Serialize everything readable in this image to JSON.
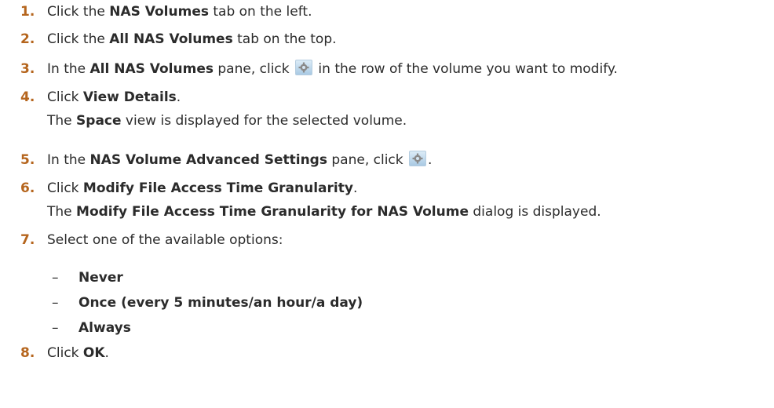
{
  "steps": [
    {
      "num": "1.",
      "pre": "Click the ",
      "bold": "NAS Volumes",
      "post": " tab on the left."
    },
    {
      "num": "2.",
      "pre": "Click the ",
      "bold": "All NAS Volumes",
      "post": " tab on the top."
    },
    {
      "num": "3.",
      "pre": "In the ",
      "bold": "All NAS Volumes",
      "mid": " pane, click ",
      "post": " in the row of the volume you want to modify."
    },
    {
      "num": "4.",
      "pre": "Click ",
      "bold": "View Details",
      "post": "."
    },
    {
      "num": "5.",
      "pre": "In the ",
      "bold": "NAS Volume Advanced Settings",
      "mid": " pane, click ",
      "post": "."
    },
    {
      "num": "6.",
      "pre": "Click ",
      "bold": "Modify File Access Time Granularity",
      "post": "."
    },
    {
      "num": "7.",
      "pre": "Select one of the available options:"
    },
    {
      "num": "8.",
      "pre": "Click ",
      "bold": "OK",
      "post": "."
    }
  ],
  "step4_note": {
    "pre": "The ",
    "bold": "Space",
    "post": " view is displayed for the selected volume."
  },
  "step6_note": {
    "pre": "The ",
    "bold": "Modify File Access Time Granularity for NAS Volume",
    "post": " dialog is displayed."
  },
  "options": {
    "dash": "–",
    "items": [
      "Never",
      "Once (every 5 minutes/an hour/a day)",
      "Always"
    ]
  },
  "icons": {
    "settings": "gear-icon"
  }
}
